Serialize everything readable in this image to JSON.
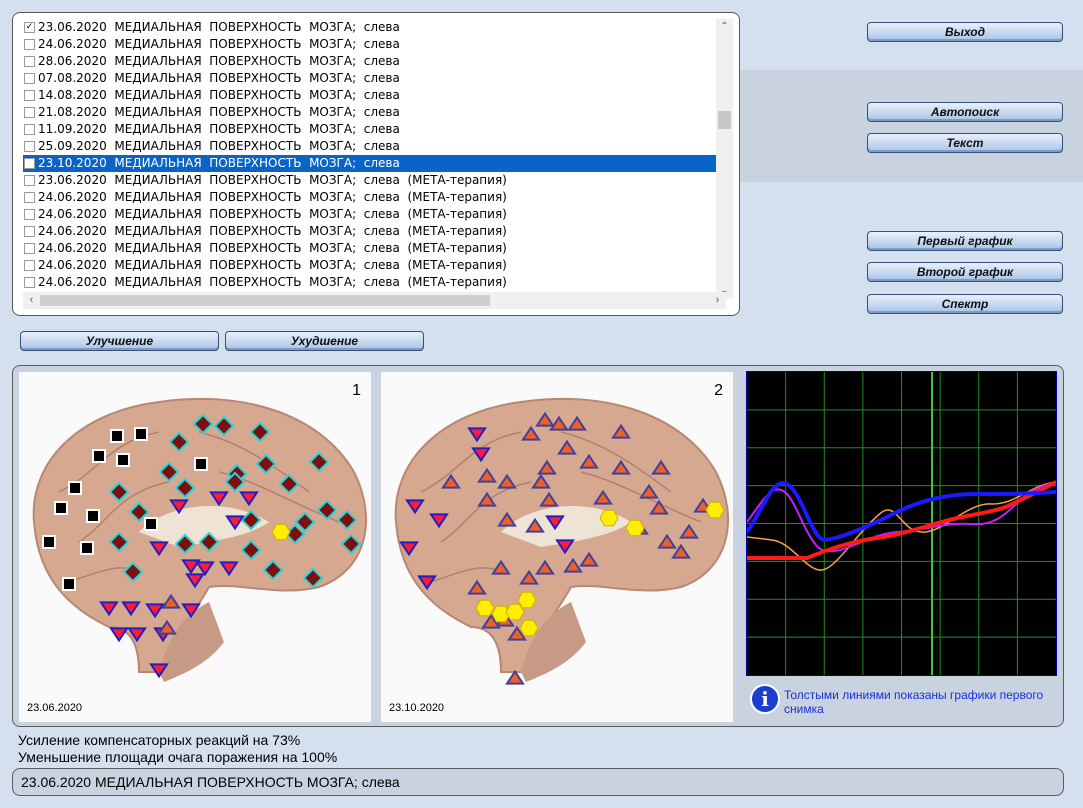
{
  "list": {
    "rows": [
      {
        "text": "23.06.2020  МЕДИАЛЬНАЯ  ПОВЕРХНОСТЬ  МОЗГА;  слева",
        "checked": true
      },
      {
        "text": "24.06.2020  МЕДИАЛЬНАЯ  ПОВЕРХНОСТЬ  МОЗГА;  слева",
        "checked": false
      },
      {
        "text": "28.06.2020  МЕДИАЛЬНАЯ  ПОВЕРХНОСТЬ  МОЗГА;  слева",
        "checked": false
      },
      {
        "text": "07.08.2020  МЕДИАЛЬНАЯ  ПОВЕРХНОСТЬ  МОЗГА;  слева",
        "checked": false
      },
      {
        "text": "14.08.2020  МЕДИАЛЬНАЯ  ПОВЕРХНОСТЬ  МОЗГА;  слева",
        "checked": false
      },
      {
        "text": "21.08.2020  МЕДИАЛЬНАЯ  ПОВЕРХНОСТЬ  МОЗГА;  слева",
        "checked": false
      },
      {
        "text": "11.09.2020  МЕДИАЛЬНАЯ  ПОВЕРХНОСТЬ  МОЗГА;  слева",
        "checked": false
      },
      {
        "text": "25.09.2020  МЕДИАЛЬНАЯ  ПОВЕРХНОСТЬ  МОЗГА;  слева",
        "checked": false
      },
      {
        "text": "23.10.2020  МЕДИАЛЬНАЯ  ПОВЕРХНОСТЬ  МОЗГА;  слева",
        "checked": false,
        "selected": true
      },
      {
        "text": "23.06.2020  МЕДИАЛЬНАЯ  ПОВЕРХНОСТЬ  МОЗГА;  слева  (МЕТА-терапия)",
        "checked": false
      },
      {
        "text": "24.06.2020  МЕДИАЛЬНАЯ  ПОВЕРХНОСТЬ  МОЗГА;  слева  (МЕТА-терапия)",
        "checked": false
      },
      {
        "text": "24.06.2020  МЕДИАЛЬНАЯ  ПОВЕРХНОСТЬ  МОЗГА;  слева  (МЕТА-терапия)",
        "checked": false
      },
      {
        "text": "24.06.2020  МЕДИАЛЬНАЯ  ПОВЕРХНОСТЬ  МОЗГА;  слева  (МЕТА-терапия)",
        "checked": false
      },
      {
        "text": "24.06.2020  МЕДИАЛЬНАЯ  ПОВЕРХНОСТЬ  МОЗГА;  слева  (МЕТА-терапия)",
        "checked": false
      },
      {
        "text": "24.06.2020  МЕДИАЛЬНАЯ  ПОВЕРХНОСТЬ  МОЗГА;  слева  (МЕТА-терапия)",
        "checked": false
      },
      {
        "text": "24.06.2020  МЕДИАЛЬНАЯ  ПОВЕРХНОСТЬ  МОЗГА;  слева  (МЕТА-терапия)",
        "checked": false
      }
    ]
  },
  "buttons": {
    "exit": "Выход",
    "autosearch": "Автопоиск",
    "text": "Текст",
    "first_graph": "Первый график",
    "second_graph": "Второй график",
    "spectrum": "Спектр",
    "improvement": "Улучшение",
    "worsening": "Ухудшение"
  },
  "images": {
    "first": {
      "number": "1",
      "date": "23.06.2020"
    },
    "second": {
      "number": "2",
      "date": "23.10.2020"
    }
  },
  "graph": {
    "info_text": "Толстыми линиями показаны графики первого снимка",
    "colors": {
      "blue": "#1a1aff",
      "red": "#ff1a1a",
      "purple": "#c020ff",
      "orange": "#ffa040",
      "grid": "#1f8f1f"
    }
  },
  "status": {
    "line1": "Усиление компенсаторных реакций на 73%",
    "line2": "Уменьшение площади очага поражения на 100%",
    "bottom": "23.06.2020 МЕДИАЛЬНАЯ  ПОВЕРХНОСТЬ  МОЗГА;  слева"
  }
}
